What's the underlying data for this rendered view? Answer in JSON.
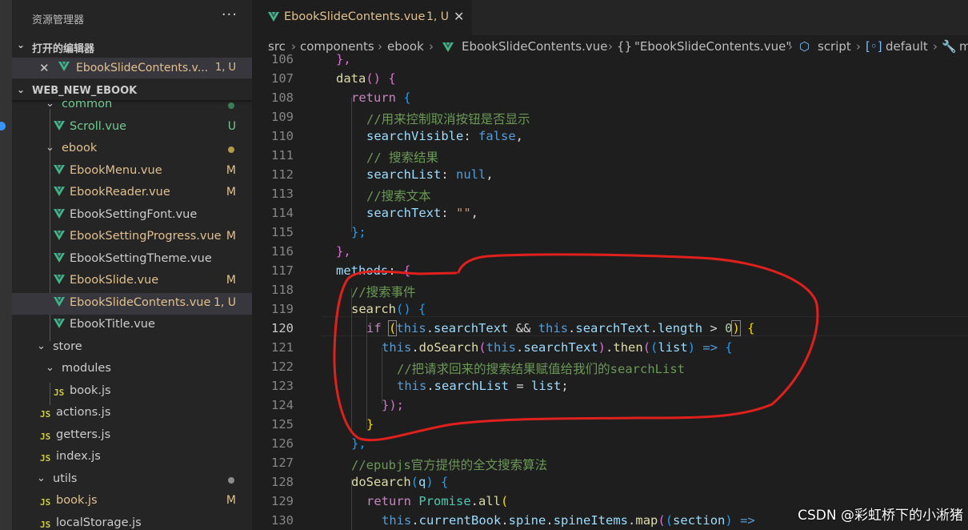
{
  "explorer": {
    "title": "资源管理器",
    "more": "···",
    "open_editors_label": "打开的编辑器",
    "open_editor": {
      "name": "EbookSlideContents.v...",
      "status": "1, U"
    },
    "project_label": "WEB_NEW_EBOOK"
  },
  "tree": [
    {
      "name": "common",
      "kind": "folder",
      "status": "",
      "color": "#73c991"
    },
    {
      "name": "Scroll.vue",
      "kind": "vue",
      "status": "U",
      "color": "#73c991"
    },
    {
      "name": "ebook",
      "kind": "folder",
      "status": "",
      "color": "#e2c08d"
    },
    {
      "name": "EbookMenu.vue",
      "kind": "vue",
      "status": "M",
      "color": "#e2c08d"
    },
    {
      "name": "EbookReader.vue",
      "kind": "vue",
      "status": "M",
      "color": "#e2c08d"
    },
    {
      "name": "EbookSettingFont.vue",
      "kind": "vue",
      "status": "",
      "color": "#cccccc"
    },
    {
      "name": "EbookSettingProgress.vue",
      "kind": "vue",
      "status": "M",
      "color": "#e2c08d"
    },
    {
      "name": "EbookSettingTheme.vue",
      "kind": "vue",
      "status": "",
      "color": "#cccccc"
    },
    {
      "name": "EbookSlide.vue",
      "kind": "vue",
      "status": "M",
      "color": "#e2c08d"
    },
    {
      "name": "EbookSlideContents.vue",
      "kind": "vue",
      "status": "1, U",
      "color": "#e2c08d"
    },
    {
      "name": "EbookTitle.vue",
      "kind": "vue",
      "status": "",
      "color": "#cccccc"
    },
    {
      "name": "store",
      "kind": "folder",
      "status": "",
      "color": "#cccccc"
    },
    {
      "name": "modules",
      "kind": "folder",
      "status": "",
      "color": "#cccccc"
    },
    {
      "name": "book.js",
      "kind": "js",
      "status": "",
      "color": "#cccccc"
    },
    {
      "name": "actions.js",
      "kind": "js",
      "status": "",
      "color": "#cccccc"
    },
    {
      "name": "getters.js",
      "kind": "js",
      "status": "",
      "color": "#cccccc"
    },
    {
      "name": "index.js",
      "kind": "js",
      "status": "",
      "color": "#cccccc"
    },
    {
      "name": "utils",
      "kind": "folder",
      "status": "",
      "color": "#cccccc"
    },
    {
      "name": "book.js",
      "kind": "js",
      "status": "M",
      "color": "#e2c08d"
    },
    {
      "name": "localStorage.js",
      "kind": "js",
      "status": "",
      "color": "#cccccc"
    }
  ],
  "tab": {
    "name": "EbookSlideContents.vue",
    "status": "1, U",
    "close": "✕"
  },
  "breadcrumbs": [
    "src",
    "components",
    "ebook",
    "EbookSlideContents.vue",
    "\"EbookSlideContents.vue\"",
    "script",
    "default",
    "m"
  ],
  "line_numbers": [
    "106",
    "107",
    "108",
    "109",
    "110",
    "111",
    "112",
    "113",
    "114",
    "115",
    "116",
    "117",
    "118",
    "119",
    "120",
    "121",
    "122",
    "123",
    "124",
    "125",
    "126",
    "127",
    "128",
    "129",
    "130"
  ],
  "code": {
    "l106": "},",
    "l107_fn": "data",
    "l107_rest": "() {",
    "l108_kw": "return",
    "l108_rest": " {",
    "l109": "//用来控制取消按钮是否显示",
    "l110_prop": "searchVisible",
    "l110_val": "false",
    "l111": "// 搜索结果",
    "l112_prop": "searchList",
    "l112_val": "null",
    "l113": "//搜索文本",
    "l114_prop": "searchText",
    "l114_val": "\"\"",
    "l115": "};",
    "l116": "},",
    "l117_prop": "methods",
    "l118": "//搜索事件",
    "l119_fn": "search",
    "l120_if": "if",
    "l120_this": "this",
    "l120_p1": "searchText",
    "l120_and": "&&",
    "l120_p2": "searchText",
    "l120_p3": "length",
    "l120_gt": ">",
    "l120_num": "0",
    "l121_fn": "doSearch",
    "l121_p": "searchText",
    "l121_then": "then",
    "l121_arg": "list",
    "l122": "//把请求回来的搜索结果赋值给我们的searchList",
    "l123_p": "searchList",
    "l123_v": "list",
    "l124": "});",
    "l125": "}",
    "l126": "},",
    "l127": "//epubjs官方提供的全文搜索算法",
    "l128_fn": "doSearch",
    "l128_arg": "q",
    "l129_kw": "return",
    "l129_t": "Promise",
    "l129_fn": "all",
    "l130_p1": "currentBook",
    "l130_p2": "spine",
    "l130_p3": "spineItems",
    "l130_fn": "map",
    "l130_arg": "section"
  },
  "watermark": "CSDN @彩虹桥下的小淅猪"
}
